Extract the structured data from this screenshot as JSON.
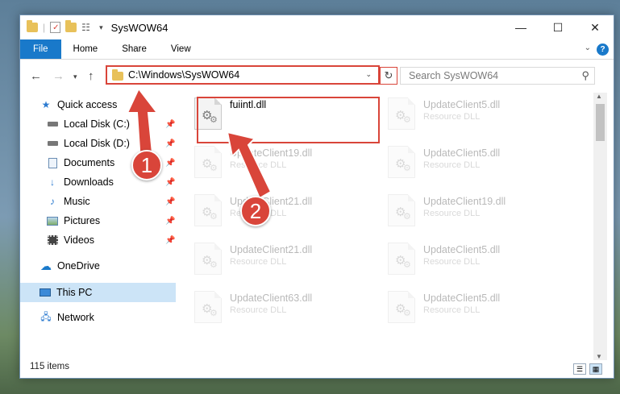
{
  "window": {
    "title": "SysWOW64",
    "controls": {
      "minimize": "—",
      "maximize": "☐",
      "close": "✕"
    }
  },
  "ribbon": {
    "tabs": [
      "File",
      "Home",
      "Share",
      "View"
    ],
    "help": "?"
  },
  "address": {
    "path": "C:\\Windows\\SysWOW64",
    "search_placeholder": "Search SysWOW64"
  },
  "sidebar": {
    "items": [
      {
        "label": "Quick access",
        "icon": "star-icon"
      },
      {
        "label": "Local Disk (C:)",
        "icon": "drive-icon",
        "pinned": true
      },
      {
        "label": "Local Disk (D:)",
        "icon": "drive-icon",
        "pinned": true
      },
      {
        "label": "Documents",
        "icon": "documents-icon",
        "pinned": true
      },
      {
        "label": "Downloads",
        "icon": "download-icon",
        "pinned": true
      },
      {
        "label": "Music",
        "icon": "music-icon",
        "pinned": true
      },
      {
        "label": "Pictures",
        "icon": "pictures-icon",
        "pinned": true
      },
      {
        "label": "Videos",
        "icon": "videos-icon",
        "pinned": true
      },
      {
        "label": "OneDrive",
        "icon": "cloud-icon"
      },
      {
        "label": "This PC",
        "icon": "computer-icon",
        "selected": true
      },
      {
        "label": "Network",
        "icon": "network-icon"
      }
    ]
  },
  "files": [
    {
      "name": "fuiintl.dll",
      "type": ""
    },
    {
      "name": "UpdateClient5.dll",
      "type": "Resource DLL"
    },
    {
      "name": "UpdateClient19.dll",
      "type": "Resource DLL"
    },
    {
      "name": "UpdateClient5.dll",
      "type": "Resource DLL"
    },
    {
      "name": "UpdateClient21.dll",
      "type": "Resource DLL"
    },
    {
      "name": "UpdateClient19.dll",
      "type": "Resource DLL"
    },
    {
      "name": "UpdateClient21.dll",
      "type": "Resource DLL"
    },
    {
      "name": "UpdateClient5.dll",
      "type": "Resource DLL"
    },
    {
      "name": "UpdateClient63.dll",
      "type": "Resource DLL"
    },
    {
      "name": "UpdateClient5.dll",
      "type": "Resource DLL"
    }
  ],
  "status": {
    "count": "115 items"
  },
  "annotations": {
    "step1": "1",
    "step2": "2"
  },
  "colors": {
    "accent": "#1979ca",
    "highlight": "#d9453a",
    "selection": "#cce4f7"
  }
}
